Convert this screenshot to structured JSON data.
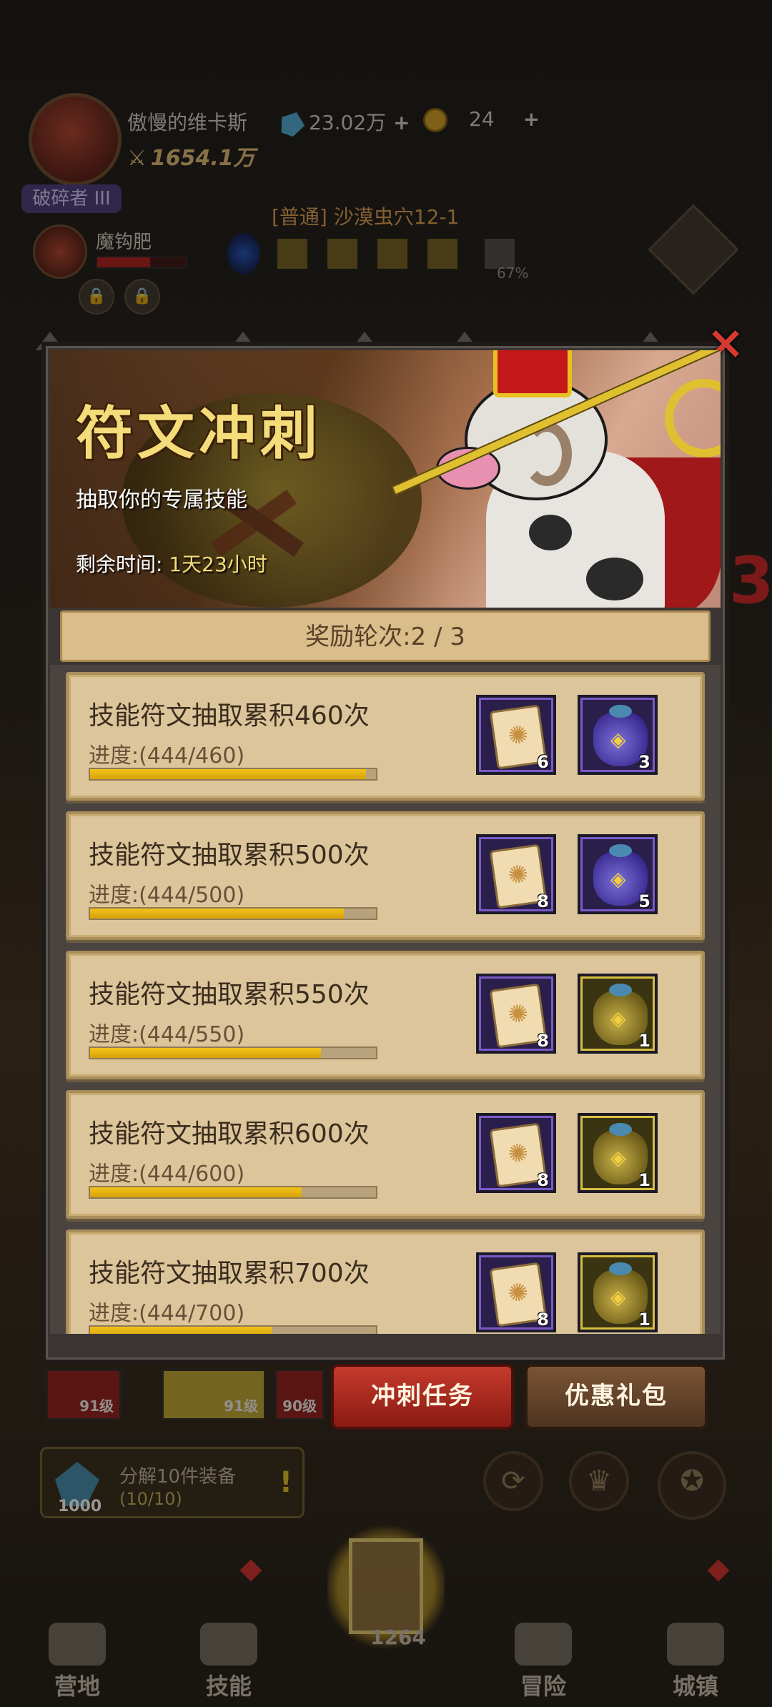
{
  "player": {
    "name": "傲慢的维卡斯",
    "power": "1654.1万",
    "rank": "破碎者 III",
    "gems": "23.02万",
    "coins": "24",
    "plus": "+"
  },
  "pet": {
    "name": "魔钩肥"
  },
  "stage": {
    "label": "[普通] 沙漠虫穴12-1",
    "percent": "67%"
  },
  "modal": {
    "close_icon": "×",
    "title": "符文冲刺",
    "subtitle": "抽取你的专属技能",
    "time_label": "剩余时间: ",
    "time_value": "1天23小时",
    "rounds": "奖励轮次:2 / 3"
  },
  "tasks": [
    {
      "title": "技能符文抽取累积460次",
      "progress": "进度:(444/460)",
      "fraction": 0.965,
      "rewards": [
        {
          "icon": "skill-scroll-icon",
          "frame": "purple",
          "count": "6"
        },
        {
          "icon": "purple-bag-icon",
          "frame": "purple",
          "count": "3"
        }
      ]
    },
    {
      "title": "技能符文抽取累积500次",
      "progress": "进度:(444/500)",
      "fraction": 0.888,
      "rewards": [
        {
          "icon": "skill-scroll-icon",
          "frame": "purple",
          "count": "8"
        },
        {
          "icon": "purple-bag-icon",
          "frame": "purple",
          "count": "5"
        }
      ]
    },
    {
      "title": "技能符文抽取累积550次",
      "progress": "进度:(444/550)",
      "fraction": 0.807,
      "rewards": [
        {
          "icon": "skill-scroll-icon",
          "frame": "purple",
          "count": "8"
        },
        {
          "icon": "gold-bag-icon",
          "frame": "gold",
          "count": "1"
        }
      ]
    },
    {
      "title": "技能符文抽取累积600次",
      "progress": "进度:(444/600)",
      "fraction": 0.74,
      "rewards": [
        {
          "icon": "skill-scroll-icon",
          "frame": "purple",
          "count": "8"
        },
        {
          "icon": "gold-bag-icon",
          "frame": "gold",
          "count": "1"
        }
      ]
    },
    {
      "title": "技能符文抽取累积700次",
      "progress": "进度:(444/700)",
      "fraction": 0.634,
      "rewards": [
        {
          "icon": "skill-scroll-icon",
          "frame": "purple",
          "count": "8"
        },
        {
          "icon": "gold-bag-icon",
          "frame": "gold",
          "count": "1"
        }
      ]
    }
  ],
  "below_modal": {
    "level_a": "91级",
    "level_b": "91级",
    "level_c": "90级",
    "sprint_tasks": "冲刺任务",
    "discount_pack": "优惠礼包"
  },
  "decompose": {
    "title": "分解10件装备",
    "progress": "(10/10)",
    "qty": "1000",
    "warn": "!"
  },
  "nav": {
    "camp": "营地",
    "skills": "技能",
    "center_count": "1264",
    "adventure": "冒险",
    "town": "城镇"
  },
  "colors": {
    "accent_gold": "#f4dc7a",
    "progress_yellow": "#f2c21a",
    "close_red": "#d43a30",
    "panel_tan": "#dcc59b"
  }
}
